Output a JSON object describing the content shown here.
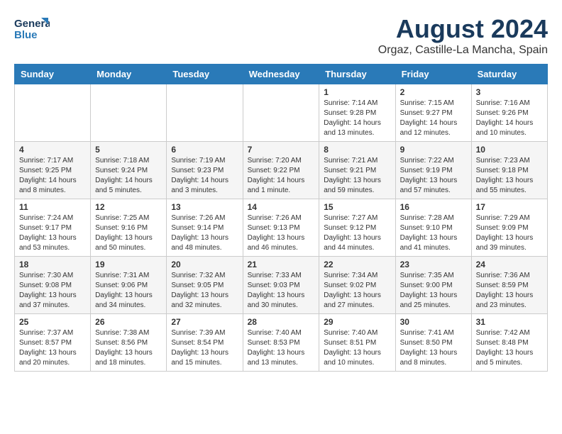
{
  "logo": {
    "line1": "General",
    "line2": "Blue"
  },
  "title": "August 2024",
  "location": "Orgaz, Castille-La Mancha, Spain",
  "days_of_week": [
    "Sunday",
    "Monday",
    "Tuesday",
    "Wednesday",
    "Thursday",
    "Friday",
    "Saturday"
  ],
  "weeks": [
    [
      {
        "day": "",
        "info": ""
      },
      {
        "day": "",
        "info": ""
      },
      {
        "day": "",
        "info": ""
      },
      {
        "day": "",
        "info": ""
      },
      {
        "day": "1",
        "info": "Sunrise: 7:14 AM\nSunset: 9:28 PM\nDaylight: 14 hours\nand 13 minutes."
      },
      {
        "day": "2",
        "info": "Sunrise: 7:15 AM\nSunset: 9:27 PM\nDaylight: 14 hours\nand 12 minutes."
      },
      {
        "day": "3",
        "info": "Sunrise: 7:16 AM\nSunset: 9:26 PM\nDaylight: 14 hours\nand 10 minutes."
      }
    ],
    [
      {
        "day": "4",
        "info": "Sunrise: 7:17 AM\nSunset: 9:25 PM\nDaylight: 14 hours\nand 8 minutes."
      },
      {
        "day": "5",
        "info": "Sunrise: 7:18 AM\nSunset: 9:24 PM\nDaylight: 14 hours\nand 5 minutes."
      },
      {
        "day": "6",
        "info": "Sunrise: 7:19 AM\nSunset: 9:23 PM\nDaylight: 14 hours\nand 3 minutes."
      },
      {
        "day": "7",
        "info": "Sunrise: 7:20 AM\nSunset: 9:22 PM\nDaylight: 14 hours\nand 1 minute."
      },
      {
        "day": "8",
        "info": "Sunrise: 7:21 AM\nSunset: 9:21 PM\nDaylight: 13 hours\nand 59 minutes."
      },
      {
        "day": "9",
        "info": "Sunrise: 7:22 AM\nSunset: 9:19 PM\nDaylight: 13 hours\nand 57 minutes."
      },
      {
        "day": "10",
        "info": "Sunrise: 7:23 AM\nSunset: 9:18 PM\nDaylight: 13 hours\nand 55 minutes."
      }
    ],
    [
      {
        "day": "11",
        "info": "Sunrise: 7:24 AM\nSunset: 9:17 PM\nDaylight: 13 hours\nand 53 minutes."
      },
      {
        "day": "12",
        "info": "Sunrise: 7:25 AM\nSunset: 9:16 PM\nDaylight: 13 hours\nand 50 minutes."
      },
      {
        "day": "13",
        "info": "Sunrise: 7:26 AM\nSunset: 9:14 PM\nDaylight: 13 hours\nand 48 minutes."
      },
      {
        "day": "14",
        "info": "Sunrise: 7:26 AM\nSunset: 9:13 PM\nDaylight: 13 hours\nand 46 minutes."
      },
      {
        "day": "15",
        "info": "Sunrise: 7:27 AM\nSunset: 9:12 PM\nDaylight: 13 hours\nand 44 minutes."
      },
      {
        "day": "16",
        "info": "Sunrise: 7:28 AM\nSunset: 9:10 PM\nDaylight: 13 hours\nand 41 minutes."
      },
      {
        "day": "17",
        "info": "Sunrise: 7:29 AM\nSunset: 9:09 PM\nDaylight: 13 hours\nand 39 minutes."
      }
    ],
    [
      {
        "day": "18",
        "info": "Sunrise: 7:30 AM\nSunset: 9:08 PM\nDaylight: 13 hours\nand 37 minutes."
      },
      {
        "day": "19",
        "info": "Sunrise: 7:31 AM\nSunset: 9:06 PM\nDaylight: 13 hours\nand 34 minutes."
      },
      {
        "day": "20",
        "info": "Sunrise: 7:32 AM\nSunset: 9:05 PM\nDaylight: 13 hours\nand 32 minutes."
      },
      {
        "day": "21",
        "info": "Sunrise: 7:33 AM\nSunset: 9:03 PM\nDaylight: 13 hours\nand 30 minutes."
      },
      {
        "day": "22",
        "info": "Sunrise: 7:34 AM\nSunset: 9:02 PM\nDaylight: 13 hours\nand 27 minutes."
      },
      {
        "day": "23",
        "info": "Sunrise: 7:35 AM\nSunset: 9:00 PM\nDaylight: 13 hours\nand 25 minutes."
      },
      {
        "day": "24",
        "info": "Sunrise: 7:36 AM\nSunset: 8:59 PM\nDaylight: 13 hours\nand 23 minutes."
      }
    ],
    [
      {
        "day": "25",
        "info": "Sunrise: 7:37 AM\nSunset: 8:57 PM\nDaylight: 13 hours\nand 20 minutes."
      },
      {
        "day": "26",
        "info": "Sunrise: 7:38 AM\nSunset: 8:56 PM\nDaylight: 13 hours\nand 18 minutes."
      },
      {
        "day": "27",
        "info": "Sunrise: 7:39 AM\nSunset: 8:54 PM\nDaylight: 13 hours\nand 15 minutes."
      },
      {
        "day": "28",
        "info": "Sunrise: 7:40 AM\nSunset: 8:53 PM\nDaylight: 13 hours\nand 13 minutes."
      },
      {
        "day": "29",
        "info": "Sunrise: 7:40 AM\nSunset: 8:51 PM\nDaylight: 13 hours\nand 10 minutes."
      },
      {
        "day": "30",
        "info": "Sunrise: 7:41 AM\nSunset: 8:50 PM\nDaylight: 13 hours\nand 8 minutes."
      },
      {
        "day": "31",
        "info": "Sunrise: 7:42 AM\nSunset: 8:48 PM\nDaylight: 13 hours\nand 5 minutes."
      }
    ]
  ]
}
